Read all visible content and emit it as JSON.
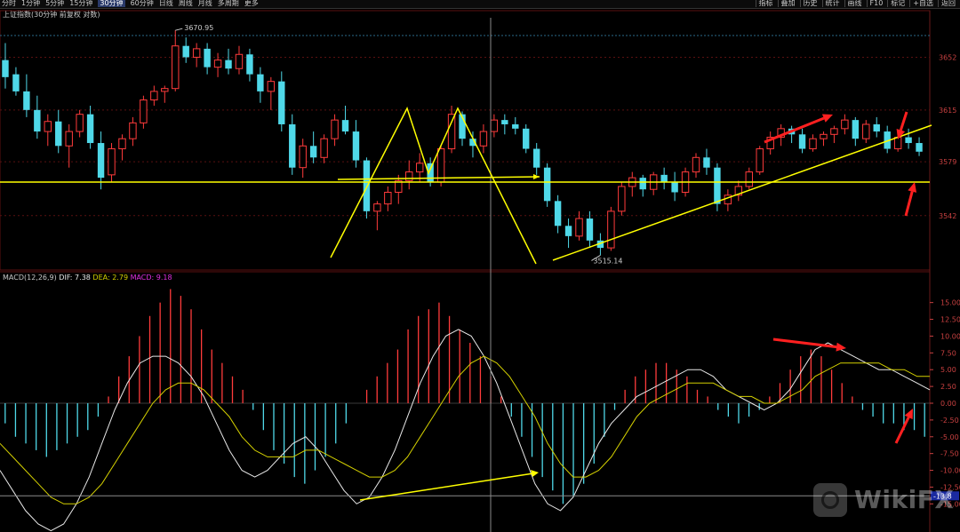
{
  "toolbar": {
    "periods": [
      "分时",
      "1分钟",
      "5分钟",
      "15分钟",
      "30分钟",
      "60分钟",
      "日线",
      "周线",
      "月线",
      "多周期",
      "更多"
    ],
    "active_period": "30分钟",
    "tools": [
      "指标",
      "叠加",
      "历史",
      "统计",
      "画线",
      "F10",
      "标记",
      "+自选",
      "返回"
    ]
  },
  "price_panel": {
    "title": "上证指数(30分钟 前复权 对数)",
    "high_label": "3670.95",
    "low_label": "3515.14"
  },
  "macd_panel": {
    "name": "MACD(12,26,9)",
    "dif_label": "DIF:",
    "dif": "7.38",
    "dea_label": "DEA:",
    "dea": "2.79",
    "macd_label": "MACD:",
    "macd": "9.18",
    "cursor_value": "-13.8"
  },
  "watermark": {
    "text": "WikiFX"
  },
  "colors": {
    "up": "#ff3b3b",
    "down": "#4fd8e8",
    "dif": "#e8e8e8",
    "dea": "#d4d000",
    "annotation": "#ffff00",
    "arrow": "#ff2020",
    "grid": "#5a1010"
  },
  "chart_data": [
    {
      "type": "candlestick",
      "title": "上证指数(30分钟 前复权 对数)",
      "y_ticks": [
        "3652",
        "3615",
        "3579",
        "3542"
      ],
      "ylim": [
        3505,
        3685
      ],
      "scale": "log",
      "grid": true,
      "marked_high": 3670.95,
      "marked_low": 3515.14,
      "series": [
        {
          "name": "candles",
          "values": [
            [
              3650,
              3662,
              3630,
              3638
            ],
            [
              3640,
              3645,
              3625,
              3628
            ],
            [
              3628,
              3640,
              3610,
              3615
            ],
            [
              3615,
              3625,
              3595,
              3600
            ],
            [
              3600,
              3612,
              3590,
              3607
            ],
            [
              3607,
              3615,
              3585,
              3590
            ],
            [
              3590,
              3605,
              3575,
              3600
            ],
            [
              3600,
              3615,
              3596,
              3612
            ],
            [
              3612,
              3618,
              3588,
              3592
            ],
            [
              3592,
              3600,
              3560,
              3568
            ],
            [
              3570,
              3592,
              3565,
              3588
            ],
            [
              3588,
              3598,
              3580,
              3595
            ],
            [
              3595,
              3610,
              3590,
              3606
            ],
            [
              3606,
              3625,
              3602,
              3622
            ],
            [
              3622,
              3632,
              3618,
              3628
            ],
            [
              3628,
              3632,
              3620,
              3630
            ],
            [
              3630,
              3671,
              3628,
              3660
            ],
            [
              3660,
              3666,
              3648,
              3652
            ],
            [
              3652,
              3662,
              3645,
              3658
            ],
            [
              3658,
              3662,
              3640,
              3645
            ],
            [
              3645,
              3655,
              3638,
              3650
            ],
            [
              3650,
              3658,
              3640,
              3644
            ],
            [
              3644,
              3660,
              3640,
              3654
            ],
            [
              3654,
              3658,
              3635,
              3640
            ],
            [
              3640,
              3645,
              3620,
              3628
            ],
            [
              3628,
              3638,
              3615,
              3635
            ],
            [
              3635,
              3642,
              3600,
              3605
            ],
            [
              3605,
              3612,
              3570,
              3575
            ],
            [
              3575,
              3595,
              3568,
              3590
            ],
            [
              3590,
              3600,
              3578,
              3582
            ],
            [
              3582,
              3598,
              3578,
              3595
            ],
            [
              3595,
              3612,
              3590,
              3608
            ],
            [
              3608,
              3618,
              3598,
              3600
            ],
            [
              3600,
              3608,
              3575,
              3580
            ],
            [
              3580,
              3582,
              3540,
              3545
            ],
            [
              3545,
              3552,
              3532,
              3550
            ],
            [
              3550,
              3562,
              3545,
              3558
            ],
            [
              3558,
              3570,
              3550,
              3566
            ],
            [
              3566,
              3580,
              3560,
              3572
            ],
            [
              3572,
              3585,
              3565,
              3578
            ],
            [
              3578,
              3582,
              3562,
              3565
            ],
            [
              3565,
              3590,
              3562,
              3588
            ],
            [
              3588,
              3618,
              3585,
              3612
            ],
            [
              3612,
              3614,
              3590,
              3595
            ],
            [
              3595,
              3600,
              3582,
              3590
            ],
            [
              3590,
              3605,
              3585,
              3600
            ],
            [
              3600,
              3612,
              3596,
              3608
            ],
            [
              3608,
              3612,
              3598,
              3605
            ],
            [
              3605,
              3610,
              3598,
              3602
            ],
            [
              3602,
              3605,
              3585,
              3588
            ],
            [
              3588,
              3592,
              3570,
              3575
            ],
            [
              3575,
              3578,
              3548,
              3552
            ],
            [
              3552,
              3556,
              3530,
              3535
            ],
            [
              3535,
              3540,
              3520,
              3528
            ],
            [
              3528,
              3545,
              3525,
              3540
            ],
            [
              3540,
              3545,
              3520,
              3525
            ],
            [
              3525,
              3530,
              3515,
              3520
            ],
            [
              3520,
              3548,
              3518,
              3545
            ],
            [
              3545,
              3565,
              3542,
              3562
            ],
            [
              3562,
              3572,
              3555,
              3568
            ],
            [
              3568,
              3570,
              3555,
              3560
            ],
            [
              3560,
              3572,
              3556,
              3570
            ],
            [
              3570,
              3575,
              3560,
              3565
            ],
            [
              3565,
              3572,
              3552,
              3558
            ],
            [
              3558,
              3575,
              3555,
              3572
            ],
            [
              3572,
              3585,
              3568,
              3582
            ],
            [
              3582,
              3588,
              3570,
              3575
            ],
            [
              3575,
              3578,
              3545,
              3550
            ],
            [
              3550,
              3560,
              3545,
              3556
            ],
            [
              3556,
              3566,
              3552,
              3562
            ],
            [
              3562,
              3575,
              3560,
              3572
            ],
            [
              3572,
              3590,
              3570,
              3588
            ],
            [
              3588,
              3600,
              3584,
              3596
            ],
            [
              3596,
              3605,
              3590,
              3602
            ],
            [
              3602,
              3604,
              3592,
              3598
            ],
            [
              3598,
              3602,
              3585,
              3588
            ],
            [
              3588,
              3598,
              3586,
              3595
            ],
            [
              3595,
              3600,
              3590,
              3598
            ],
            [
              3598,
              3604,
              3592,
              3602
            ],
            [
              3602,
              3612,
              3598,
              3608
            ],
            [
              3608,
              3610,
              3590,
              3595
            ],
            [
              3595,
              3608,
              3592,
              3605
            ],
            [
              3605,
              3610,
              3596,
              3600
            ],
            [
              3600,
              3604,
              3585,
              3588
            ],
            [
              3588,
              3600,
              3586,
              3596
            ],
            [
              3596,
              3602,
              3588,
              3592
            ],
            [
              3592,
              3596,
              3583,
              3586
            ]
          ]
        }
      ]
    },
    {
      "type": "bar+line",
      "title": "MACD(12,26,9)",
      "y_ticks": [
        "15.00",
        "12.50",
        "10.00",
        "7.50",
        "5.00",
        "2.50",
        "0.00",
        "-2.50",
        "-5.00",
        "-7.50",
        "-10.00",
        "-12.50",
        "-15.00"
      ],
      "ylim": [
        -18,
        18
      ],
      "grid": false,
      "series": [
        {
          "name": "MACD",
          "values": [
            -3,
            -5,
            -6,
            -7,
            -8,
            -7,
            -6,
            -5,
            -4,
            -2,
            1,
            4,
            7,
            10,
            13,
            15,
            17,
            16,
            14,
            11,
            8,
            6,
            4,
            2,
            -1,
            -4,
            -7,
            -9,
            -11,
            -12,
            -10,
            -8,
            -6,
            -3,
            0,
            2,
            4,
            6,
            8,
            11,
            13,
            14,
            15,
            13,
            11,
            9,
            7,
            4,
            1,
            -2,
            -5,
            -8,
            -11,
            -13,
            -15,
            -14,
            -12,
            -9,
            -5,
            -1,
            2,
            4,
            5,
            6,
            6,
            5,
            4,
            2,
            1,
            -1,
            -2,
            -3,
            -2,
            -1,
            1,
            3,
            5,
            7,
            8,
            7,
            5,
            3,
            1,
            -1,
            -2,
            -3,
            -3,
            -4,
            -4,
            -5
          ]
        },
        {
          "name": "DIF",
          "values": [
            -10,
            -13,
            -16,
            -18,
            -19,
            -18,
            -15,
            -11,
            -6,
            -1,
            3,
            6,
            7,
            7,
            6,
            4,
            1,
            -3,
            -7,
            -10,
            -11,
            -10,
            -8,
            -6,
            -5,
            -7,
            -10,
            -13,
            -15,
            -14,
            -11,
            -7,
            -2,
            3,
            7,
            10,
            11,
            10,
            7,
            3,
            -2,
            -7,
            -12,
            -15,
            -16,
            -14,
            -10,
            -6,
            -3,
            -1,
            1,
            2,
            3,
            4,
            5,
            5,
            4,
            2,
            1,
            0,
            -1,
            0,
            2,
            5,
            8,
            9,
            8,
            7,
            6,
            5,
            5,
            4,
            3,
            2
          ]
        },
        {
          "name": "DEA",
          "values": [
            -6,
            -8,
            -10,
            -12,
            -14,
            -15,
            -15,
            -14,
            -12,
            -9,
            -6,
            -3,
            0,
            2,
            3,
            3,
            2,
            0,
            -2,
            -5,
            -7,
            -8,
            -8,
            -8,
            -7,
            -7,
            -8,
            -9,
            -10,
            -11,
            -11,
            -10,
            -8,
            -5,
            -2,
            1,
            4,
            6,
            7,
            6,
            4,
            1,
            -2,
            -6,
            -9,
            -11,
            -11,
            -10,
            -8,
            -5,
            -2,
            0,
            1,
            2,
            3,
            3,
            3,
            2,
            1,
            1,
            0,
            0,
            1,
            2,
            4,
            5,
            6,
            6,
            6,
            6,
            5,
            5,
            4,
            4
          ]
        }
      ]
    }
  ]
}
